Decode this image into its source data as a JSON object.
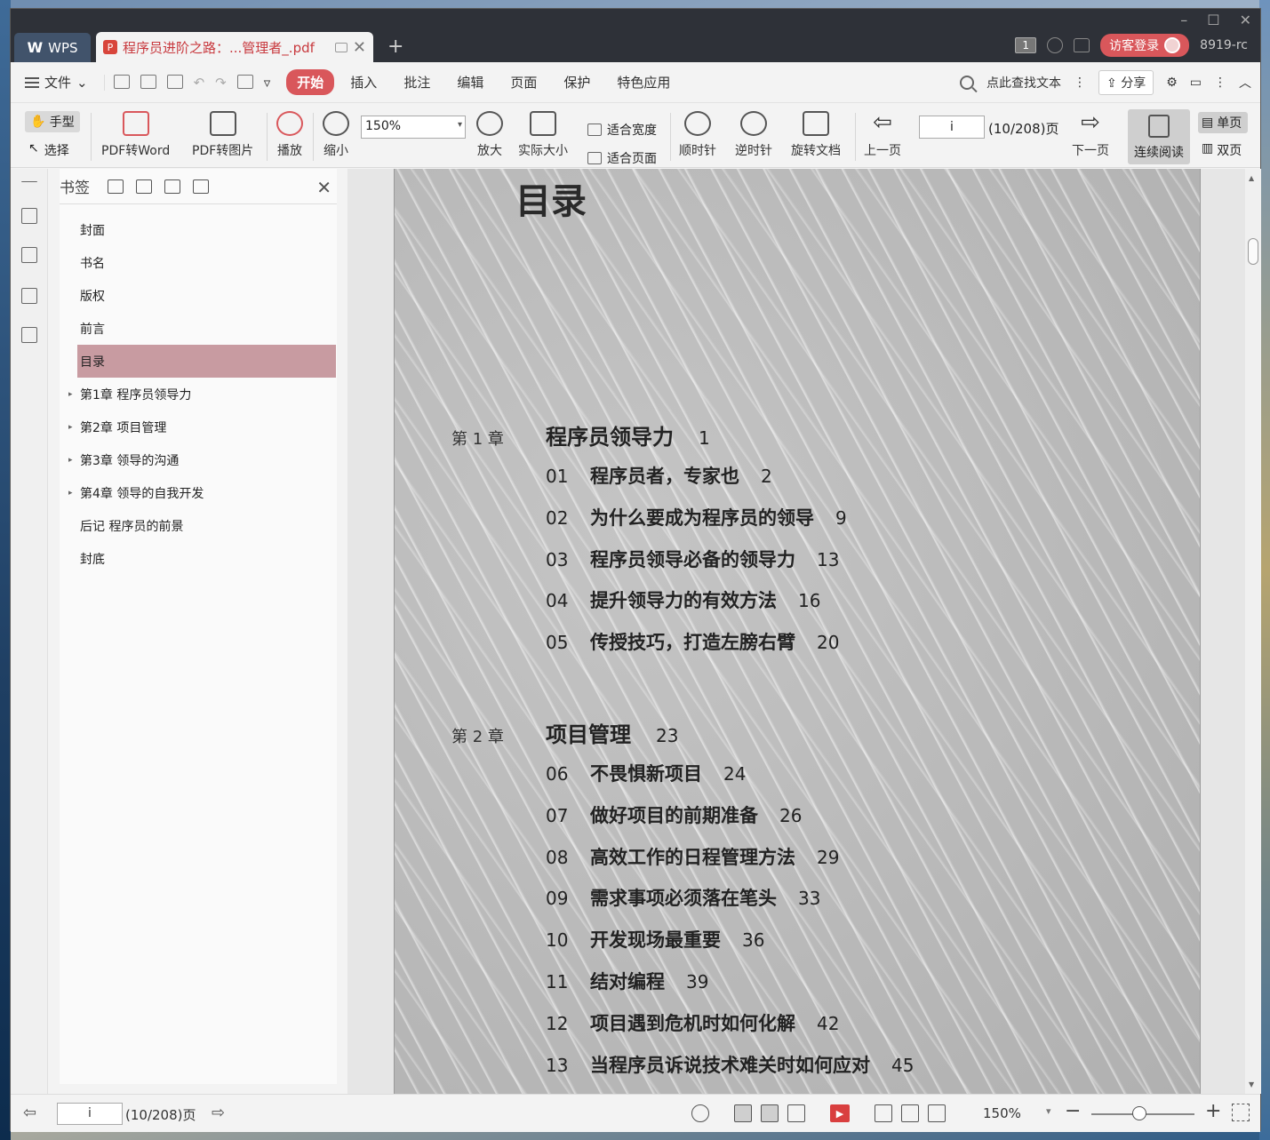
{
  "titlebar": {
    "app_tab": "WPS",
    "doc_tab_title": "程序员进阶之路：...管理者_.pdf",
    "badge_count": "1",
    "login_label": "访客登录",
    "user_id": "8919-rc"
  },
  "menubar": {
    "file_label": "文件",
    "items": [
      "开始",
      "插入",
      "批注",
      "编辑",
      "页面",
      "保护",
      "特色应用"
    ],
    "active_index": 0,
    "search_placeholder": "点此查找文本",
    "share_label": "分享"
  },
  "toolbar": {
    "hand_label": "手型",
    "select_label": "选择",
    "pdf_to_word": "PDF转Word",
    "pdf_to_image": "PDF转图片",
    "play": "播放",
    "zoom_out": "缩小",
    "zoom_value": "150%",
    "zoom_in": "放大",
    "actual_size": "实际大小",
    "fit_width": "适合宽度",
    "fit_page": "适合页面",
    "clockwise": "顺时针",
    "counterclockwise": "逆时针",
    "rotate_doc": "旋转文档",
    "prev_page": "上一页",
    "page_value": "i",
    "page_count": "(10/208)页",
    "next_page": "下一页",
    "continuous_read": "连续阅读",
    "single_page": "单页",
    "double_page": "双页"
  },
  "bookmarks": {
    "title": "书签",
    "items": [
      {
        "label": "封面",
        "expandable": false
      },
      {
        "label": "书名",
        "expandable": false
      },
      {
        "label": "版权",
        "expandable": false
      },
      {
        "label": "前言",
        "expandable": false
      },
      {
        "label": "目录",
        "expandable": false,
        "selected": true
      },
      {
        "label": "第1章  程序员领导力",
        "expandable": true
      },
      {
        "label": "第2章  项目管理",
        "expandable": true
      },
      {
        "label": "第3章  领导的沟通",
        "expandable": true
      },
      {
        "label": "第4章  领导的自我开发",
        "expandable": true
      },
      {
        "label": "后记  程序员的前景",
        "expandable": false
      },
      {
        "label": "封底",
        "expandable": false
      }
    ]
  },
  "document": {
    "page_title": "目录",
    "chapters": [
      {
        "label": "第 1 章",
        "title": "程序员领导力",
        "page": "1",
        "entries": [
          {
            "num": "01",
            "text": "程序员者，专家也",
            "page": "2"
          },
          {
            "num": "02",
            "text": "为什么要成为程序员的领导",
            "page": "9"
          },
          {
            "num": "03",
            "text": "程序员领导必备的领导力",
            "page": "13"
          },
          {
            "num": "04",
            "text": "提升领导力的有效方法",
            "page": "16"
          },
          {
            "num": "05",
            "text": "传授技巧，打造左膀右臂",
            "page": "20"
          }
        ]
      },
      {
        "label": "第 2 章",
        "title": "项目管理",
        "page": "23",
        "entries": [
          {
            "num": "06",
            "text": "不畏惧新项目",
            "page": "24"
          },
          {
            "num": "07",
            "text": "做好项目的前期准备",
            "page": "26"
          },
          {
            "num": "08",
            "text": "高效工作的日程管理方法",
            "page": "29"
          },
          {
            "num": "09",
            "text": "需求事项必须落在笔头",
            "page": "33"
          },
          {
            "num": "10",
            "text": "开发现场最重要",
            "page": "36"
          },
          {
            "num": "11",
            "text": "结对编程",
            "page": "39"
          },
          {
            "num": "12",
            "text": "项目遇到危机时如何化解",
            "page": "42"
          },
          {
            "num": "13",
            "text": "当程序员诉说技术难关时如何应对",
            "page": "45"
          }
        ]
      }
    ]
  },
  "statusbar": {
    "page_value": "i",
    "page_count": "(10/208)页",
    "zoom_value": "150%"
  },
  "colors": {
    "accent": "#d9575b",
    "selected_bookmark": "#c89ba1",
    "titlebar_bg": "#2e3138"
  }
}
